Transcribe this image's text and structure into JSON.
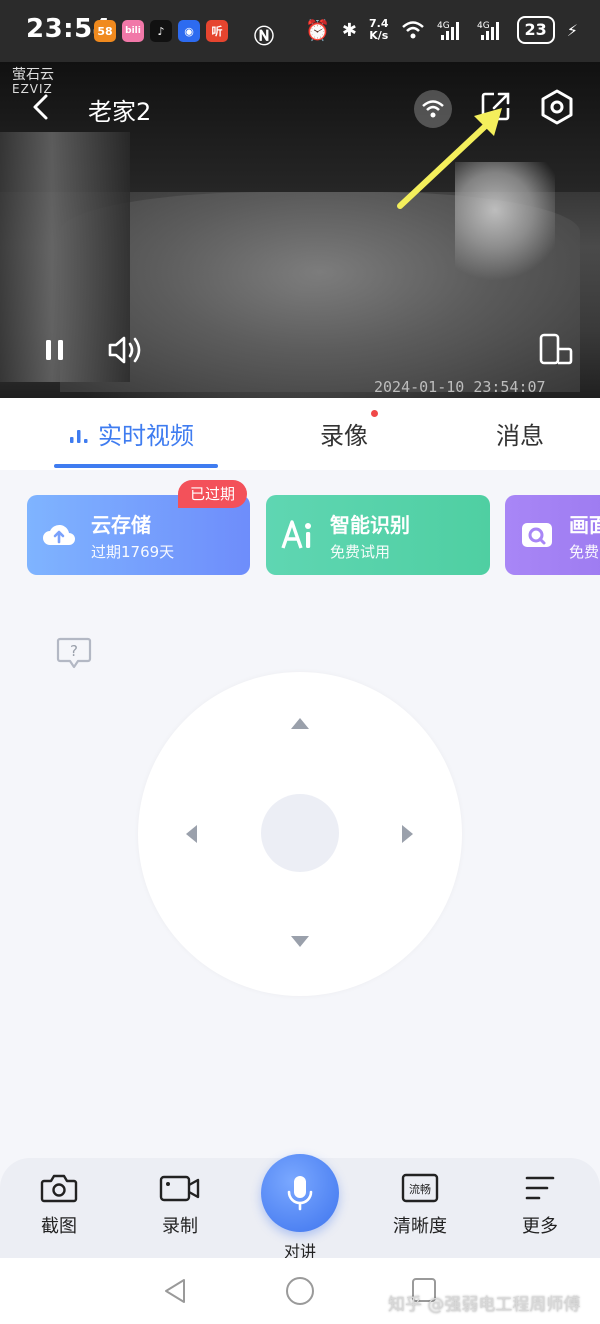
{
  "status_bar": {
    "time": "23:54",
    "app_icons": [
      {
        "name": "58",
        "color": "#f08a1e"
      },
      {
        "name": "bili",
        "color": "#f178a8"
      },
      {
        "name": "tiktok",
        "color": "#111111"
      },
      {
        "name": "app-blue",
        "color": "#2d6bf0"
      },
      {
        "name": "听",
        "color": "#e6452f"
      }
    ],
    "net_speed_value": "7.4",
    "net_speed_unit": "K/s",
    "battery": "23"
  },
  "video": {
    "logo_cn": "萤石云",
    "logo_en": "EZVIZ",
    "title": "老家2",
    "timestamp": "2024-01-10 23:54:07"
  },
  "tabs": {
    "live": "实时视频",
    "recording": "录像",
    "messages": "消息"
  },
  "cards": {
    "cloud": {
      "title": "云存储",
      "subtitle": "过期1769天",
      "badge": "已过期"
    },
    "ai": {
      "title": "智能识别",
      "subtitle": "免费试用"
    },
    "screen": {
      "title": "画面",
      "subtitle": "免费"
    }
  },
  "toolbar": {
    "screenshot": "截图",
    "record": "录制",
    "talk": "对讲",
    "clarity": "清晰度",
    "clarity_badge": "流畅",
    "more": "更多"
  },
  "watermark": "知乎 @强弱电工程周师傅",
  "colors": {
    "accent": "#3f7cf0",
    "badge_red": "#f3515a",
    "arrow_yellow": "#f4ef5c"
  }
}
